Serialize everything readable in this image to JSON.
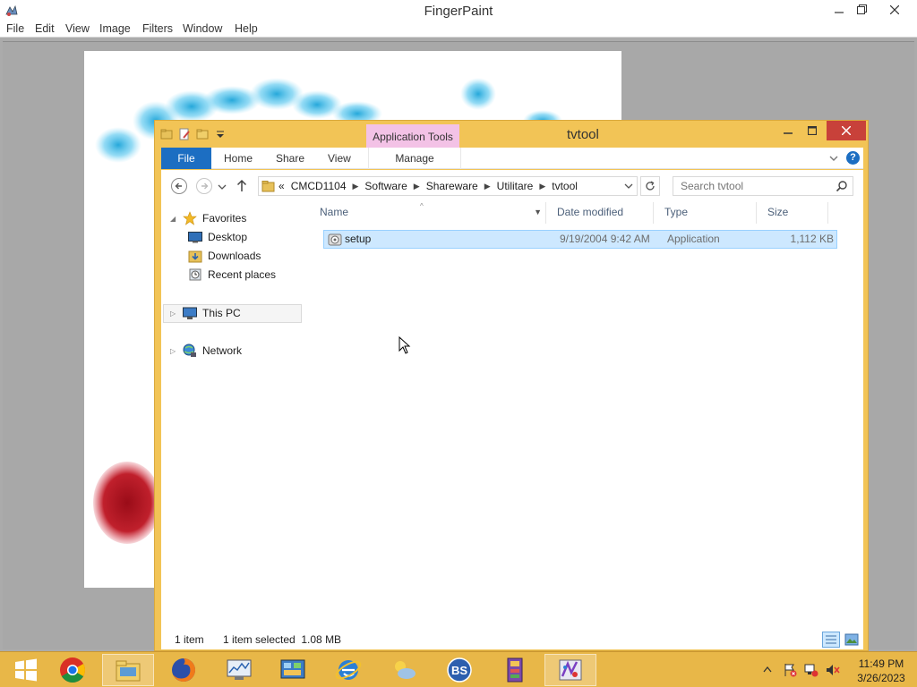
{
  "fingerpaint": {
    "title": "FingerPaint",
    "menu": [
      "File",
      "Edit",
      "View",
      "Image",
      "Filters",
      "Window",
      "Help"
    ]
  },
  "explorer": {
    "title": "tvtool",
    "context_tab_header": "Application Tools",
    "ribbon_tabs": {
      "file": "File",
      "home": "Home",
      "share": "Share",
      "view": "View",
      "manage": "Manage"
    },
    "address": {
      "prefix": "«",
      "crumbs": [
        "CMCD1104",
        "Software",
        "Shareware",
        "Utilitare",
        "tvtool"
      ]
    },
    "search": {
      "placeholder": "Search tvtool"
    },
    "nav": {
      "favorites": "Favorites",
      "desktop": "Desktop",
      "downloads": "Downloads",
      "recent": "Recent places",
      "this_pc": "This PC",
      "network": "Network"
    },
    "columns": {
      "name": "Name",
      "date": "Date modified",
      "type": "Type",
      "size": "Size"
    },
    "files": [
      {
        "name": "setup",
        "date": "9/19/2004 9:42 AM",
        "type": "Application",
        "size": "1,112 KB"
      }
    ],
    "status": {
      "count": "1 item",
      "selection": "1 item selected  1.08 MB"
    }
  },
  "taskbar": {
    "time": "11:49 PM",
    "date": "3/26/2023",
    "apps": [
      "start-icon",
      "chrome-icon",
      "file-explorer-icon",
      "firefox-icon",
      "performance-monitor-icon",
      "control-panel-icon",
      "internet-explorer-icon",
      "weather-app-icon",
      "bs-app-icon",
      "archive-app-icon",
      "fingerpaint-icon"
    ]
  },
  "colors": {
    "window_frame": "#f2c456",
    "taskbar": "#e8b748",
    "file_tab": "#1c6ec2",
    "selection": "#cde8ff",
    "context_tab": "#f3c2e6",
    "close_button": "#c8413a"
  }
}
